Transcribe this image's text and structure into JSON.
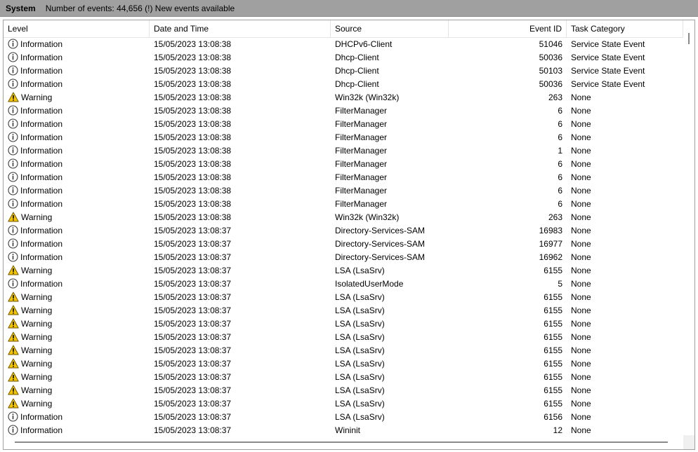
{
  "title": "System",
  "status": "Number of events: 44,656 (!) New events available",
  "columns": [
    "Level",
    "Date and Time",
    "Source",
    "Event ID",
    "Task Category"
  ],
  "rows": [
    {
      "level": "Information",
      "icon": "information-icon",
      "datetime": "15/05/2023 13:08:38",
      "source": "DHCPv6-Client",
      "event_id": "51046",
      "category": "Service State Event"
    },
    {
      "level": "Information",
      "icon": "information-icon",
      "datetime": "15/05/2023 13:08:38",
      "source": "Dhcp-Client",
      "event_id": "50036",
      "category": "Service State Event"
    },
    {
      "level": "Information",
      "icon": "information-icon",
      "datetime": "15/05/2023 13:08:38",
      "source": "Dhcp-Client",
      "event_id": "50103",
      "category": "Service State Event"
    },
    {
      "level": "Information",
      "icon": "information-icon",
      "datetime": "15/05/2023 13:08:38",
      "source": "Dhcp-Client",
      "event_id": "50036",
      "category": "Service State Event"
    },
    {
      "level": "Warning",
      "icon": "warning-icon",
      "datetime": "15/05/2023 13:08:38",
      "source": "Win32k (Win32k)",
      "event_id": "263",
      "category": "None"
    },
    {
      "level": "Information",
      "icon": "information-icon",
      "datetime": "15/05/2023 13:08:38",
      "source": "FilterManager",
      "event_id": "6",
      "category": "None"
    },
    {
      "level": "Information",
      "icon": "information-icon",
      "datetime": "15/05/2023 13:08:38",
      "source": "FilterManager",
      "event_id": "6",
      "category": "None"
    },
    {
      "level": "Information",
      "icon": "information-icon",
      "datetime": "15/05/2023 13:08:38",
      "source": "FilterManager",
      "event_id": "6",
      "category": "None"
    },
    {
      "level": "Information",
      "icon": "information-icon",
      "datetime": "15/05/2023 13:08:38",
      "source": "FilterManager",
      "event_id": "1",
      "category": "None"
    },
    {
      "level": "Information",
      "icon": "information-icon",
      "datetime": "15/05/2023 13:08:38",
      "source": "FilterManager",
      "event_id": "6",
      "category": "None"
    },
    {
      "level": "Information",
      "icon": "information-icon",
      "datetime": "15/05/2023 13:08:38",
      "source": "FilterManager",
      "event_id": "6",
      "category": "None"
    },
    {
      "level": "Information",
      "icon": "information-icon",
      "datetime": "15/05/2023 13:08:38",
      "source": "FilterManager",
      "event_id": "6",
      "category": "None"
    },
    {
      "level": "Information",
      "icon": "information-icon",
      "datetime": "15/05/2023 13:08:38",
      "source": "FilterManager",
      "event_id": "6",
      "category": "None"
    },
    {
      "level": "Warning",
      "icon": "warning-icon",
      "datetime": "15/05/2023 13:08:38",
      "source": "Win32k (Win32k)",
      "event_id": "263",
      "category": "None"
    },
    {
      "level": "Information",
      "icon": "information-icon",
      "datetime": "15/05/2023 13:08:37",
      "source": "Directory-Services-SAM",
      "event_id": "16983",
      "category": "None"
    },
    {
      "level": "Information",
      "icon": "information-icon",
      "datetime": "15/05/2023 13:08:37",
      "source": "Directory-Services-SAM",
      "event_id": "16977",
      "category": "None"
    },
    {
      "level": "Information",
      "icon": "information-icon",
      "datetime": "15/05/2023 13:08:37",
      "source": "Directory-Services-SAM",
      "event_id": "16962",
      "category": "None"
    },
    {
      "level": "Warning",
      "icon": "warning-icon",
      "datetime": "15/05/2023 13:08:37",
      "source": "LSA (LsaSrv)",
      "event_id": "6155",
      "category": "None"
    },
    {
      "level": "Information",
      "icon": "information-icon",
      "datetime": "15/05/2023 13:08:37",
      "source": "IsolatedUserMode",
      "event_id": "5",
      "category": "None"
    },
    {
      "level": "Warning",
      "icon": "warning-icon",
      "datetime": "15/05/2023 13:08:37",
      "source": "LSA (LsaSrv)",
      "event_id": "6155",
      "category": "None"
    },
    {
      "level": "Warning",
      "icon": "warning-icon",
      "datetime": "15/05/2023 13:08:37",
      "source": "LSA (LsaSrv)",
      "event_id": "6155",
      "category": "None"
    },
    {
      "level": "Warning",
      "icon": "warning-icon",
      "datetime": "15/05/2023 13:08:37",
      "source": "LSA (LsaSrv)",
      "event_id": "6155",
      "category": "None"
    },
    {
      "level": "Warning",
      "icon": "warning-icon",
      "datetime": "15/05/2023 13:08:37",
      "source": "LSA (LsaSrv)",
      "event_id": "6155",
      "category": "None"
    },
    {
      "level": "Warning",
      "icon": "warning-icon",
      "datetime": "15/05/2023 13:08:37",
      "source": "LSA (LsaSrv)",
      "event_id": "6155",
      "category": "None"
    },
    {
      "level": "Warning",
      "icon": "warning-icon",
      "datetime": "15/05/2023 13:08:37",
      "source": "LSA (LsaSrv)",
      "event_id": "6155",
      "category": "None"
    },
    {
      "level": "Warning",
      "icon": "warning-icon",
      "datetime": "15/05/2023 13:08:37",
      "source": "LSA (LsaSrv)",
      "event_id": "6155",
      "category": "None"
    },
    {
      "level": "Warning",
      "icon": "warning-icon",
      "datetime": "15/05/2023 13:08:37",
      "source": "LSA (LsaSrv)",
      "event_id": "6155",
      "category": "None"
    },
    {
      "level": "Warning",
      "icon": "warning-icon",
      "datetime": "15/05/2023 13:08:37",
      "source": "LSA (LsaSrv)",
      "event_id": "6155",
      "category": "None"
    },
    {
      "level": "Information",
      "icon": "information-icon",
      "datetime": "15/05/2023 13:08:37",
      "source": "LSA (LsaSrv)",
      "event_id": "6156",
      "category": "None"
    },
    {
      "level": "Information",
      "icon": "information-icon",
      "datetime": "15/05/2023 13:08:37",
      "source": "Wininit",
      "event_id": "12",
      "category": "None"
    }
  ]
}
